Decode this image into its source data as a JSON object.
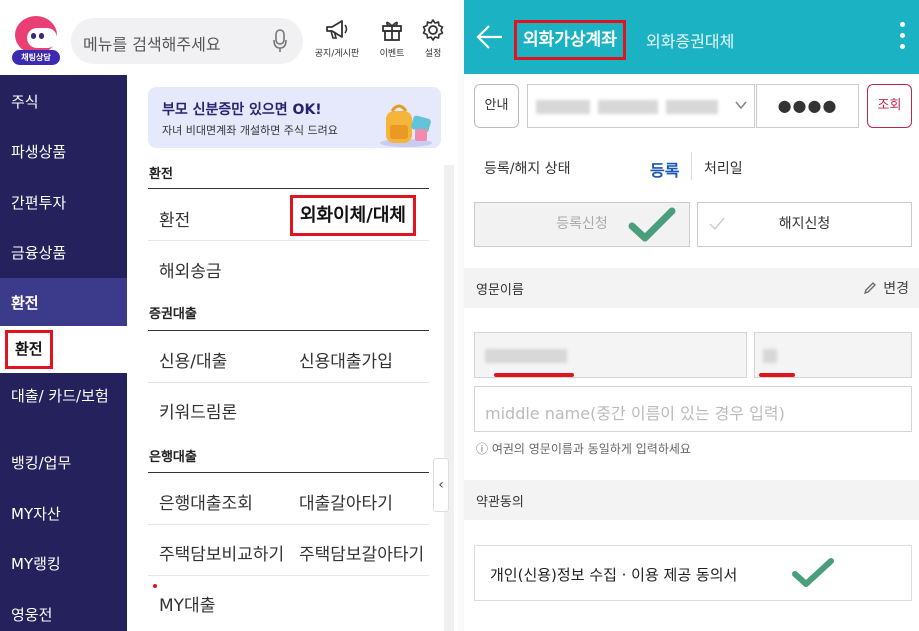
{
  "left": {
    "bot": {
      "badge": "채팅상담"
    },
    "search": {
      "placeholder": "메뉴를 검색해주세요"
    },
    "top_icons": [
      {
        "icon": "megaphone-icon",
        "label": "공지/게시판"
      },
      {
        "icon": "gift-icon",
        "label": "이벤트"
      },
      {
        "icon": "gear-icon",
        "label": "설정"
      }
    ],
    "sidebar": [
      "주식",
      "파생상품",
      "간편투자",
      "금융상품",
      "환전",
      "환전",
      "대출/ 카드/보험",
      "뱅킹/업무",
      "MY자산",
      "MY랭킹",
      "영웅전"
    ],
    "banner": {
      "title": "부모 신분증만 있으면  OK!",
      "subtitle": "자녀 비대면계좌 개설하면 주식 드려요"
    },
    "sections": {
      "exchange": {
        "title": "환전",
        "items": [
          "환전",
          "외화이체/대체",
          "해외송금"
        ]
      },
      "securities_loan": {
        "title": "증권대출",
        "items": [
          "신용/대출",
          "신용대출가입",
          "키워드림론"
        ]
      },
      "bank_loan": {
        "title": "은행대출",
        "items": [
          "은행대출조회",
          "대출갈아타기",
          "주택담보비교하기",
          "주택담보갈아타기",
          "MY대출"
        ]
      }
    },
    "colors": {
      "sidebar_bg": "#24215c",
      "highlight": "#e0141e"
    }
  },
  "right": {
    "header": {
      "active_tab": "외화가상계좌",
      "inactive_tab": "외화증권대체"
    },
    "account_row": {
      "guide_button": "안내",
      "password_mask": "●●●●",
      "query_button": "조회"
    },
    "status": {
      "label": "등록/해지 상태",
      "value": "등록",
      "date_label": "처리일"
    },
    "actions": {
      "register": "등록신청",
      "cancel": "해지신청"
    },
    "english_name": {
      "title": "영문이름",
      "edit": "변경",
      "middle_placeholder": "middle name(중간 이름이 있는 경우 입력)",
      "hint": "ⓘ 여권의 영문이름과 동일하게 입력하세요"
    },
    "terms": {
      "title": "약관동의",
      "item": "개인(신용)정보 수집 · 이용 제공 동의서"
    },
    "colors": {
      "header_bg": "#1bb3c3",
      "check_green": "#4a9e7c",
      "status_blue": "#1a56b5"
    }
  }
}
